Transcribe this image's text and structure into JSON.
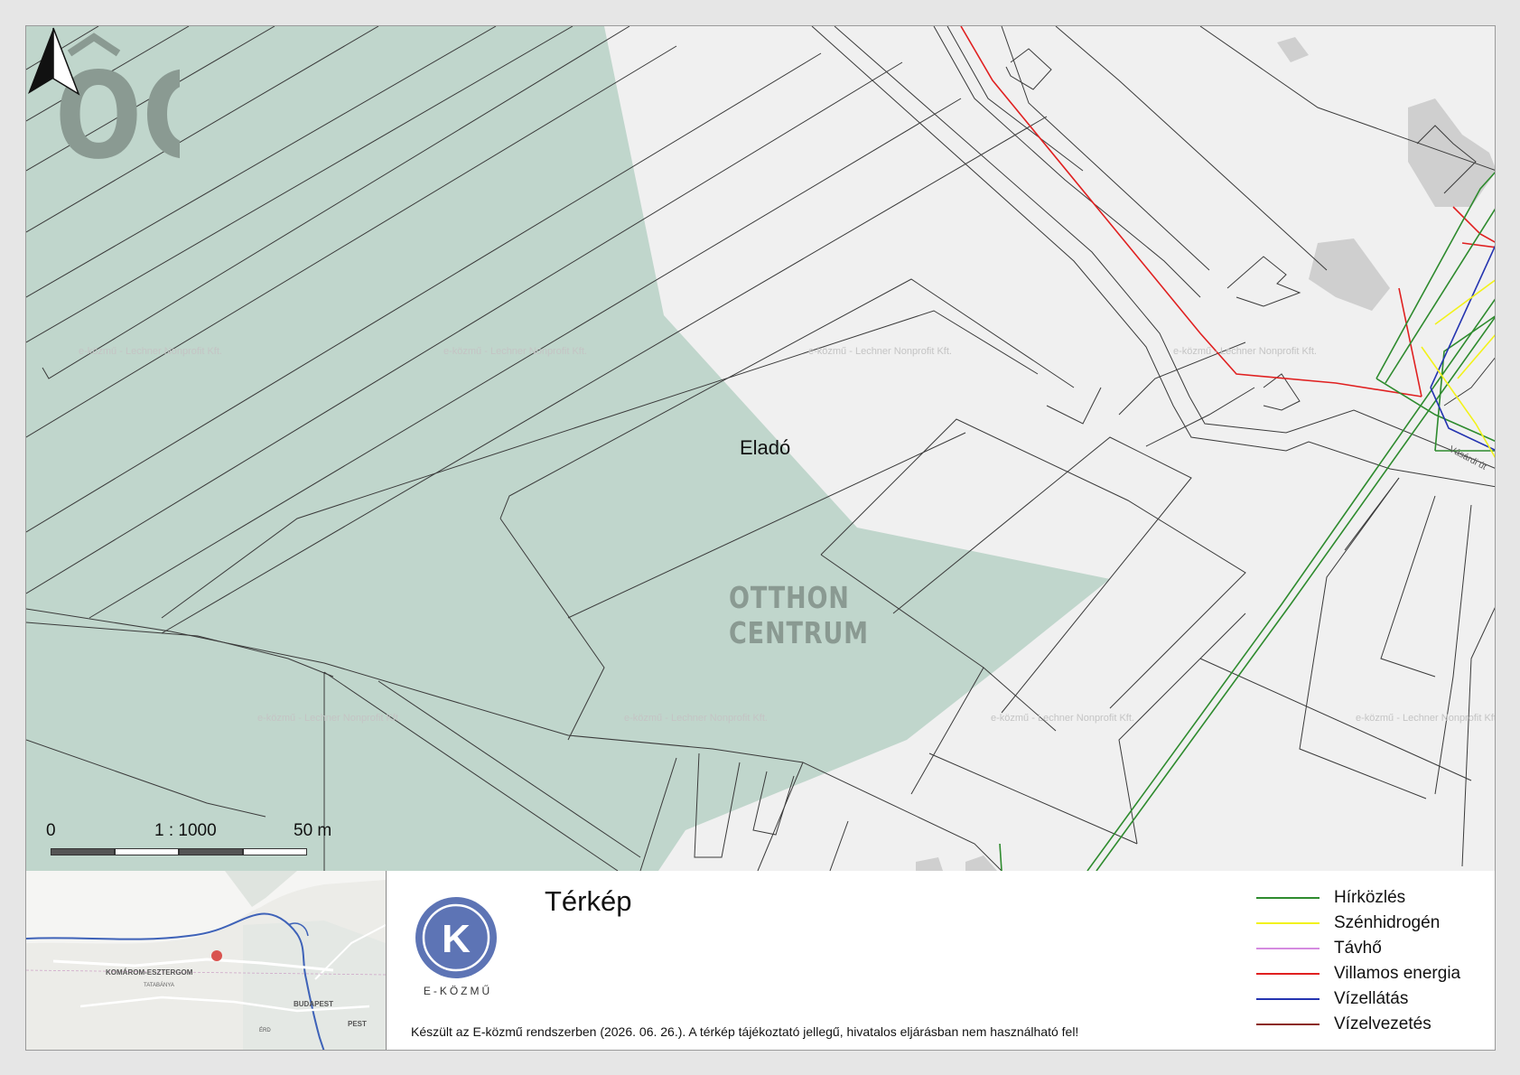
{
  "map": {
    "watermark_text": "e-közmű - Lechner Nonprofit Kft.",
    "listing_label": "Eladó",
    "logo": {
      "monogram": "OC",
      "line1": "OTTHON",
      "line2": "CENTRUM"
    },
    "street_label": "Vásárdi út",
    "colors": {
      "background": "#f0f0f0",
      "parcel_fill": "#c0d6cc",
      "parcel_stroke": "#3a3a3a",
      "building": "#cfcfcf",
      "logo": "#8a9a92"
    },
    "north_arrow_icon": "north-arrow-icon"
  },
  "scale": {
    "start": "0",
    "ratio": "1 : 1000",
    "end": "50 m"
  },
  "footer": {
    "title": "Térkép",
    "brand": "E-KÖZMŰ",
    "brand_letter": "K",
    "brand_color": "#5d74b5",
    "disclaimer": "Készült az E-közmű rendszerben (2026. 06. 26.). A térkép tájékoztató jellegű, hivatalos eljárásban nem használható fel!",
    "overview": {
      "labels": [
        "KOMÁROM-ESZTERGOM",
        "TATABÁNYA",
        "BUDAPEST",
        "PEST",
        "ÉRD"
      ]
    },
    "legend": [
      {
        "label": "Hírközlés",
        "color": "#2e8b2e"
      },
      {
        "label": "Szénhidrogén",
        "color": "#f2f21a"
      },
      {
        "label": "Távhő",
        "color": "#d58be0"
      },
      {
        "label": "Villamos energia",
        "color": "#e02020"
      },
      {
        "label": "Vízellátás",
        "color": "#2434b0"
      },
      {
        "label": "Vízelvezetés",
        "color": "#8b2a1a"
      }
    ]
  }
}
